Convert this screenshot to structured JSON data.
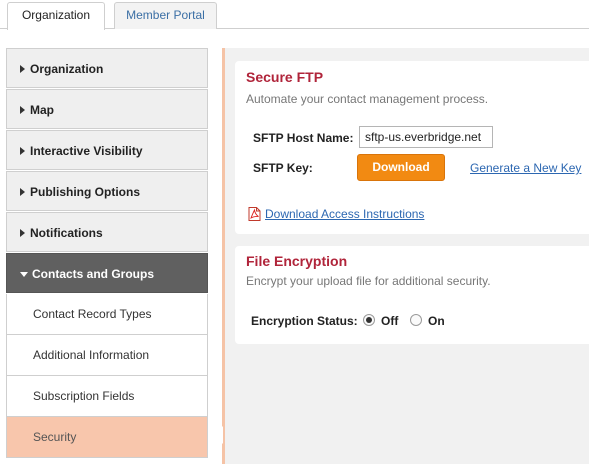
{
  "tabs": [
    {
      "label": "Organization",
      "active": true
    },
    {
      "label": "Member Portal",
      "active": false
    }
  ],
  "sidebar": {
    "items": [
      {
        "label": "Organization",
        "expanded": false
      },
      {
        "label": "Map",
        "expanded": false
      },
      {
        "label": "Interactive Visibility",
        "expanded": false
      },
      {
        "label": "Publishing Options",
        "expanded": false
      },
      {
        "label": "Notifications",
        "expanded": false
      },
      {
        "label": "Contacts and Groups",
        "expanded": true
      }
    ],
    "subitems": [
      {
        "label": "Contact Record Types",
        "selected": false
      },
      {
        "label": "Additional Information",
        "selected": false
      },
      {
        "label": "Subscription Fields",
        "selected": false
      },
      {
        "label": "Security",
        "selected": true
      }
    ]
  },
  "sftp": {
    "title": "Secure FTP",
    "description": "Automate your contact management process.",
    "host_label": "SFTP Host Name:",
    "host_value": "sftp-us.everbridge.net",
    "key_label": "SFTP Key:",
    "download_label": "Download",
    "generate_label": "Generate a New Key",
    "instructions_label": "Download Access Instructions"
  },
  "encryption": {
    "title": "File Encryption",
    "description": "Encrypt your upload file for additional security.",
    "status_label": "Encryption Status:",
    "options": [
      {
        "label": "Off",
        "checked": true
      },
      {
        "label": "On",
        "checked": false
      }
    ]
  },
  "icons": {
    "pdf": "pdf-icon",
    "expand": "triangle-right-icon",
    "collapse": "triangle-down-icon"
  },
  "colors": {
    "accent_title": "#b0243a",
    "download_button": "#f28a12",
    "selected_item": "#f8c6ac",
    "open_section": "#606060",
    "link": "#2c67b1"
  }
}
